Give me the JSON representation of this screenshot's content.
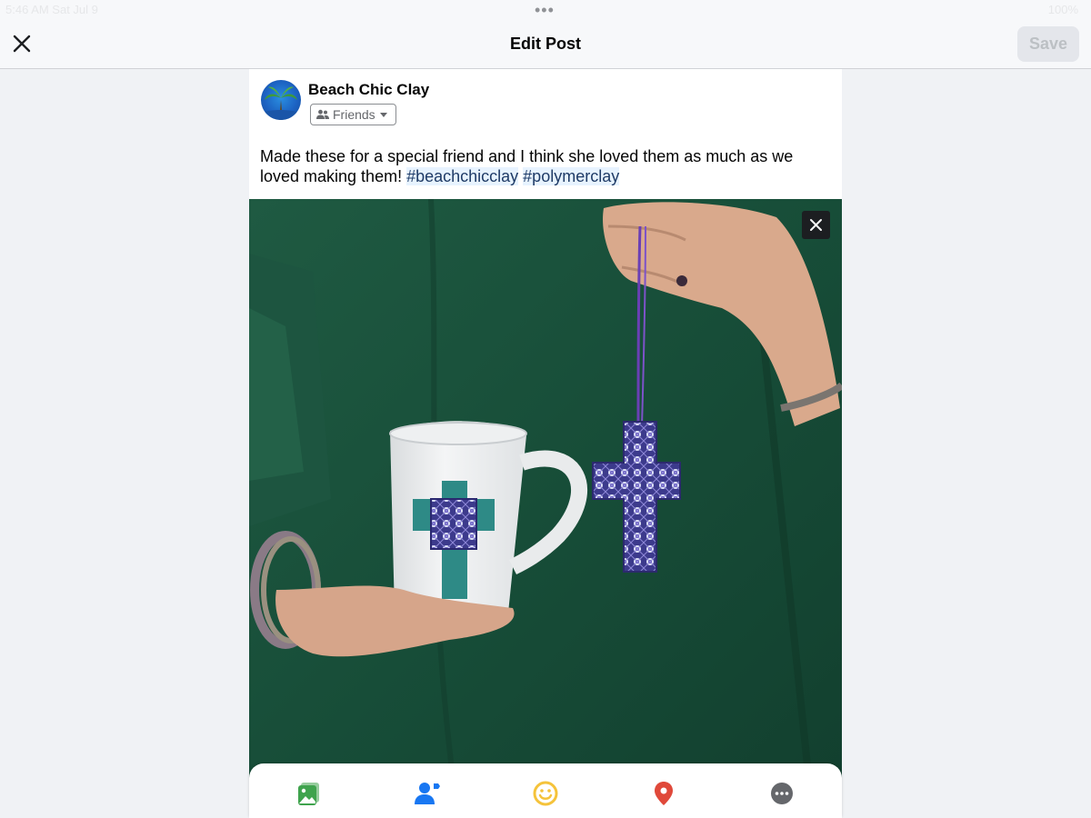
{
  "status_bar": {
    "time": "5:46 AM   Sat Jul 9",
    "battery": "100%"
  },
  "header": {
    "title": "Edit Post",
    "save_label": "Save",
    "close_icon": "close-icon"
  },
  "post": {
    "author": "Beach Chic Clay",
    "audience": "Friends",
    "text_plain": "Made these for a special friend and I think she loved them as much as we loved making them! ",
    "hashtags": [
      "#beachchicclay",
      "#polymerclay"
    ]
  },
  "toolbar": {
    "items": [
      "photo-icon",
      "tag-people-icon",
      "feeling-icon",
      "location-icon",
      "more-icon"
    ]
  },
  "colors": {
    "accent_blue": "#1877f2",
    "photo_green": "#3fa34d",
    "feeling_yellow": "#f5c33b",
    "location_red": "#e0493a",
    "more_gray": "#65676b"
  }
}
